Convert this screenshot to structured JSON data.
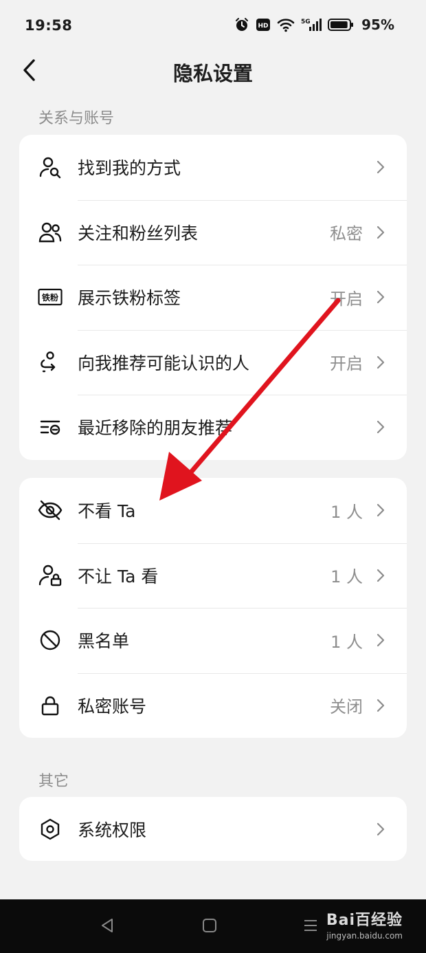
{
  "status_bar": {
    "time": "19:58",
    "network": "5G",
    "battery_percent": "95%",
    "battery_level": 0.95
  },
  "header": {
    "title": "隐私设置"
  },
  "sections": [
    {
      "label": "关系与账号",
      "items": [
        {
          "label": "找到我的方式",
          "value": "",
          "icon": "person-search-icon"
        },
        {
          "label": "关注和粉丝列表",
          "value": "私密",
          "icon": "people-icon"
        },
        {
          "label": "展示铁粉标签",
          "value": "开启",
          "icon": "fan-badge-icon",
          "icon_text": "铁粉"
        },
        {
          "label": "向我推荐可能认识的人",
          "value": "开启",
          "icon": "route-recommend-icon"
        },
        {
          "label": "最近移除的朋友推荐",
          "value": "",
          "icon": "list-removed-icon"
        }
      ]
    },
    {
      "label": "",
      "items": [
        {
          "label": "不看 Ta",
          "value": "1 人",
          "icon": "eye-off-icon"
        },
        {
          "label": "不让 Ta 看",
          "value": "1 人",
          "icon": "person-lock-icon"
        },
        {
          "label": "黑名单",
          "value": "1 人",
          "icon": "block-icon"
        },
        {
          "label": "私密账号",
          "value": "关闭",
          "icon": "lock-icon"
        }
      ]
    },
    {
      "label": "其它",
      "items": [
        {
          "label": "系统权限",
          "value": "",
          "icon": "hexagon-settings-icon"
        }
      ]
    }
  ],
  "watermark": {
    "main": "Bai百经验",
    "sub": "jingyan.baidu.com"
  },
  "colors": {
    "background": "#f2f2f2",
    "card": "#ffffff",
    "secondary_text": "#8e8e8e",
    "annotation_arrow": "#e0141e"
  }
}
